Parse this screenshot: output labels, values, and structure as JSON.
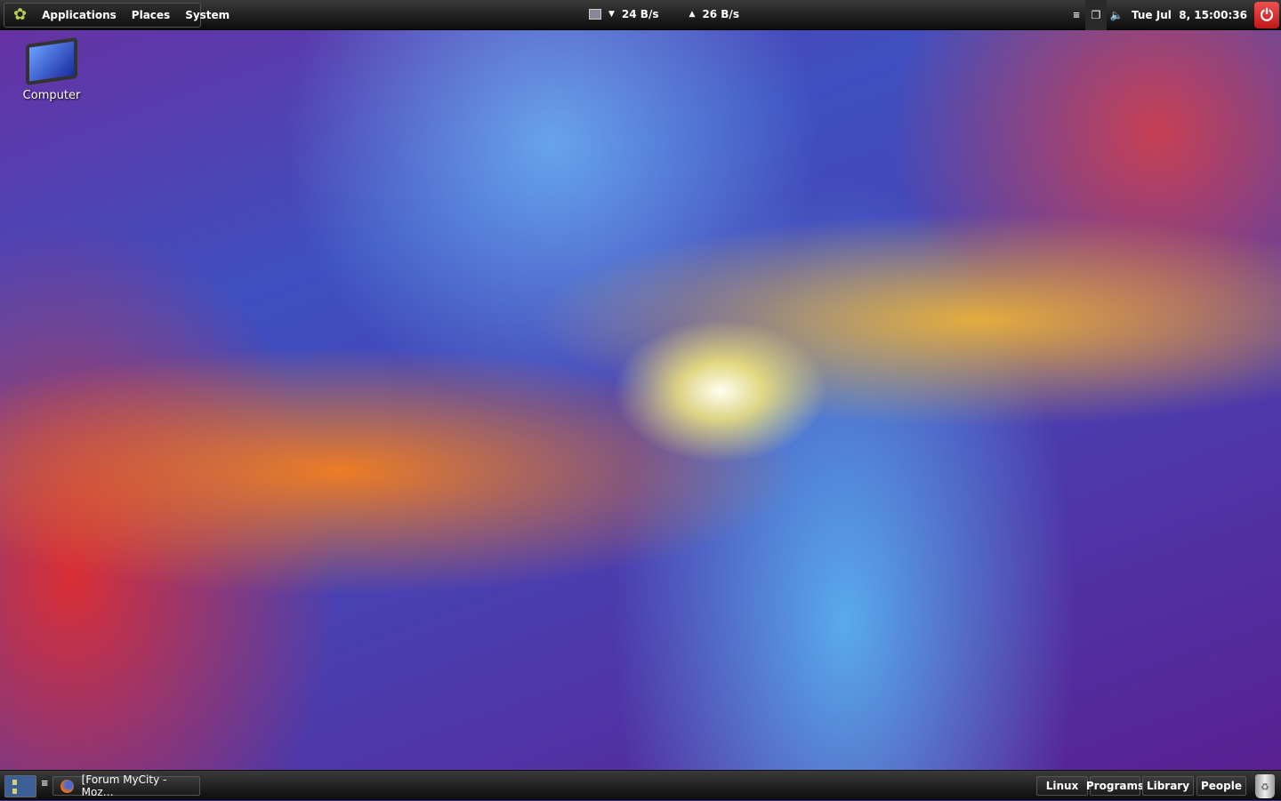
{
  "top_panel": {
    "menus": [
      "Applications",
      "Places",
      "System"
    ],
    "net_down": "24 B/s",
    "net_up": "26 B/s",
    "clock": "Tue Jul  8, 15:00:36"
  },
  "desktop": {
    "icons": [
      {
        "label": "Computer"
      }
    ]
  },
  "bottom_panel": {
    "task": "[Forum MyCity - Moz…",
    "launchers": [
      "Linux",
      "Programs",
      "Library",
      "People"
    ]
  },
  "colors": {
    "power": "#e03030",
    "panel": "#1a1a1a"
  }
}
